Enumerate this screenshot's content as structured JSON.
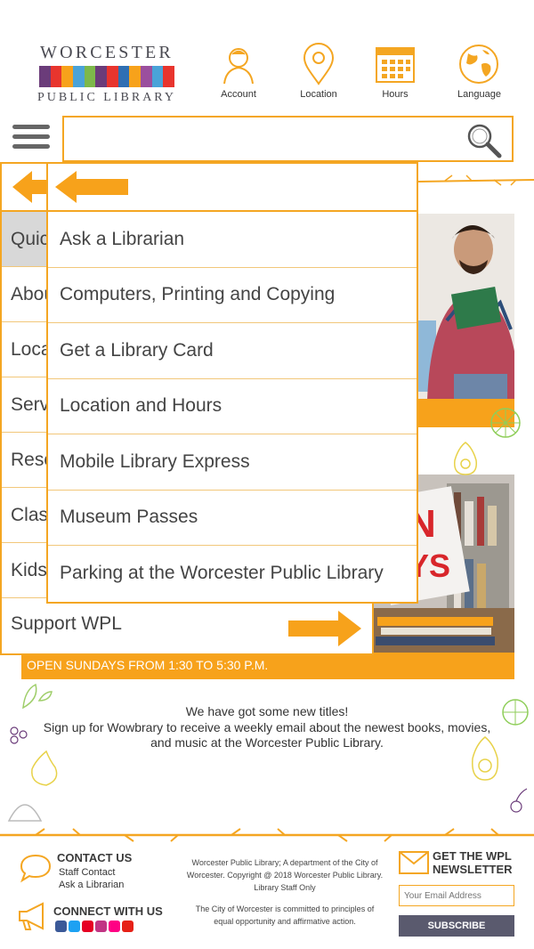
{
  "header": {
    "logo": {
      "line1": "WORCESTER",
      "line2": "PUBLIC LIBRARY",
      "strip_colors": [
        "#6b3c7a",
        "#e8352e",
        "#f7a21b",
        "#4aa3d8",
        "#7db84a",
        "#6b3c7a",
        "#e8352e",
        "#2f6fb3",
        "#f7a21b",
        "#9b4f9e",
        "#4aa3d8",
        "#e8352e"
      ]
    },
    "nav": [
      {
        "label": "Account",
        "icon": "account-icon"
      },
      {
        "label": "Location",
        "icon": "location-pin-icon"
      },
      {
        "label": "Hours",
        "icon": "calendar-icon"
      },
      {
        "label": "Language",
        "icon": "globe-icon"
      }
    ],
    "search": {
      "placeholder": "",
      "value": ""
    }
  },
  "main_menu": {
    "items": [
      {
        "label": "Quick Links",
        "active": true
      },
      {
        "label": "About"
      },
      {
        "label": "Locations"
      },
      {
        "label": "Services"
      },
      {
        "label": "Resources"
      },
      {
        "label": "Classes"
      },
      {
        "label": "Kids"
      },
      {
        "label": "Support WPL"
      }
    ]
  },
  "submenu": {
    "items": [
      {
        "label": "Ask a Librarian"
      },
      {
        "label": "Computers, Printing and Copying"
      },
      {
        "label": "Get a Library Card"
      },
      {
        "label": "Location and Hours"
      },
      {
        "label": "Mobile Library Express"
      },
      {
        "label": "Museum Passes"
      },
      {
        "label": "Parking at the Worcester Public Library"
      }
    ]
  },
  "page": {
    "banner": "OPEN SUNDAYS FROM 1:30 TO 5:30 P.M.",
    "promo_title": "We have got some new titles!",
    "promo_body": "Sign up for Wowbrary to receive a weekly email about the newest books, movies, and music at the Worcester Public Library."
  },
  "footer": {
    "contact_title": "CONTACT US",
    "contact_links": [
      "Staff Contact",
      "Ask a Librarian"
    ],
    "connect_title": "CONNECT WITH US",
    "social_colors": [
      "#3b5998",
      "#1da1f2",
      "#e60023",
      "#c13584",
      "#ff0084",
      "#e62117"
    ],
    "center_text_1": "Worcester Public Library; A department of the City of Worcester. Copyright @ 2018 Worcester Public Library. Library Staff Only",
    "center_text_2": "The City of Worcester is committed to principles of equal opportunity and affirmative action.",
    "newsletter_title_1": "GET THE WPL",
    "newsletter_title_2": "NEWSLETTER",
    "email_placeholder": "Your Email Address",
    "subscribe_label": "SUBSCRIBE"
  },
  "colors": {
    "accent": "#f7a21b",
    "border": "#f4a622",
    "active_bg": "#d8d8d8",
    "button": "#5a5a6e"
  }
}
